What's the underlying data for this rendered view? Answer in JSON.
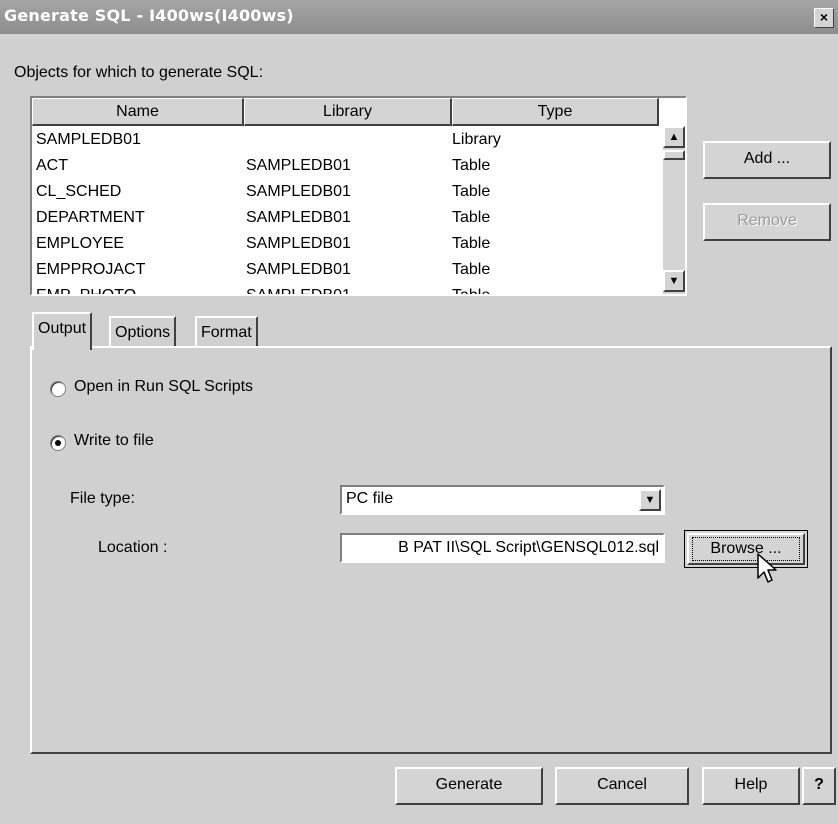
{
  "window": {
    "title": "Generate SQL - I400ws(I400ws)",
    "close_glyph": "×"
  },
  "objects": {
    "label": "Objects for which to generate SQL:",
    "columns": [
      "Name",
      "Library",
      "Type"
    ],
    "rows": [
      {
        "name": "SAMPLEDB01",
        "library": "",
        "type": "Library"
      },
      {
        "name": "ACT",
        "library": "SAMPLEDB01",
        "type": "Table"
      },
      {
        "name": "CL_SCHED",
        "library": "SAMPLEDB01",
        "type": "Table"
      },
      {
        "name": "DEPARTMENT",
        "library": "SAMPLEDB01",
        "type": "Table"
      },
      {
        "name": "EMPLOYEE",
        "library": "SAMPLEDB01",
        "type": "Table"
      },
      {
        "name": "EMPPROJACT",
        "library": "SAMPLEDB01",
        "type": "Table"
      },
      {
        "name": "EMP_PHOTO",
        "library": "SAMPLEDB01",
        "type": "Table"
      }
    ],
    "scroll_up_glyph": "▲",
    "scroll_down_glyph": "▼"
  },
  "side_buttons": {
    "add": "Add ...",
    "remove": "Remove"
  },
  "tabs": [
    "Output",
    "Options",
    "Format"
  ],
  "output": {
    "option_run_sql": "Open in Run SQL Scripts",
    "option_write_file": "Write to file",
    "selected_option": "Write to file",
    "file_type_label": "File type:",
    "file_type_value": "PC file",
    "location_label": "Location :",
    "location_value": "B PAT II\\SQL Script\\GENSQL012.sql",
    "browse_label": "Browse ...",
    "dropdown_glyph": "▼"
  },
  "footer_buttons": {
    "generate": "Generate",
    "cancel": "Cancel",
    "help": "Help",
    "whats_this": "?"
  },
  "icons": {
    "cursor": "mouse-pointer-icon"
  }
}
